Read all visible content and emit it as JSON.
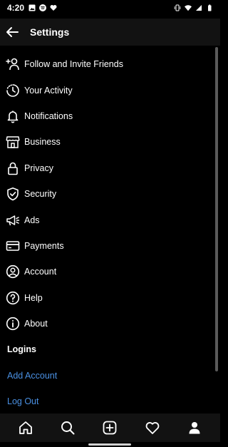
{
  "status_bar": {
    "time": "4:20",
    "left_icons": [
      "image-icon",
      "spotify-icon",
      "heart-icon"
    ],
    "right_icons": [
      "vibrate-icon",
      "wifi-icon",
      "signal-icon",
      "battery-icon"
    ]
  },
  "header": {
    "title": "Settings",
    "back_icon": "arrow-left-icon"
  },
  "menu": {
    "items": [
      {
        "label": "Follow and Invite Friends",
        "icon": "add-person-icon"
      },
      {
        "label": "Your Activity",
        "icon": "activity-clock-icon"
      },
      {
        "label": "Notifications",
        "icon": "bell-icon"
      },
      {
        "label": "Business",
        "icon": "shop-icon"
      },
      {
        "label": "Privacy",
        "icon": "lock-icon"
      },
      {
        "label": "Security",
        "icon": "shield-check-icon"
      },
      {
        "label": "Ads",
        "icon": "megaphone-icon"
      },
      {
        "label": "Payments",
        "icon": "credit-card-icon"
      },
      {
        "label": "Account",
        "icon": "account-circle-icon"
      },
      {
        "label": "Help",
        "icon": "help-circle-icon"
      },
      {
        "label": "About",
        "icon": "info-circle-icon"
      }
    ],
    "logins_section": "Logins",
    "add_account": "Add Account",
    "log_out": "Log Out"
  },
  "bottom_nav": {
    "items": [
      "home-icon",
      "search-icon",
      "add-icon",
      "heart-icon",
      "profile-icon"
    ]
  },
  "colors": {
    "background": "#000000",
    "bar": "#121212",
    "text": "#ffffff",
    "link": "#4a90e2"
  }
}
